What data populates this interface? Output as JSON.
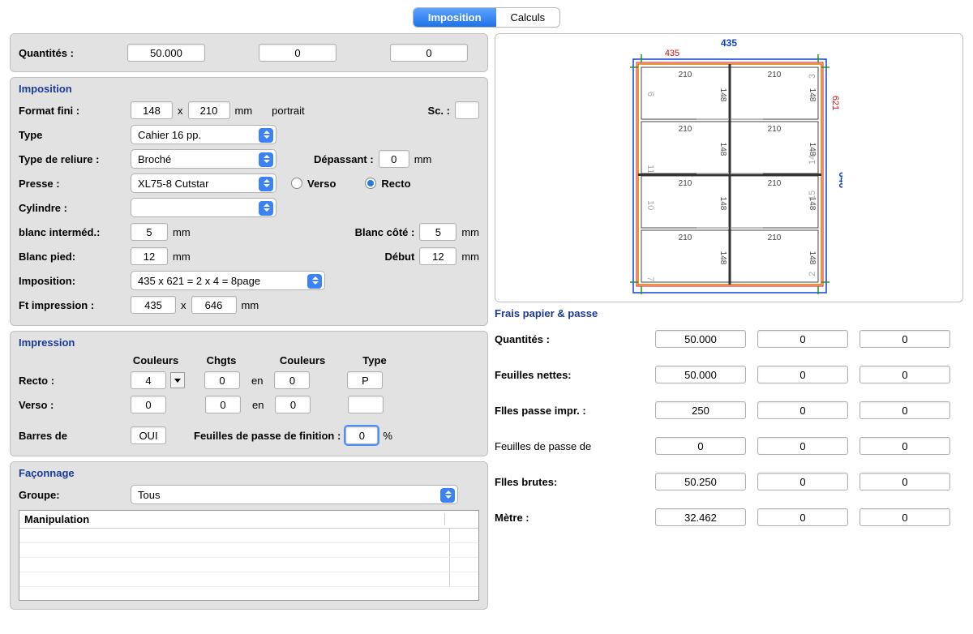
{
  "tabs": {
    "imposition": "Imposition",
    "calculs": "Calculs"
  },
  "quantites": {
    "label": "Quantités :",
    "v1": "50.000",
    "v2": "0",
    "v3": "0"
  },
  "imposition": {
    "title": "Imposition",
    "format_fini_label": "Format fini :",
    "format_w": "148",
    "format_x": "x",
    "format_h": "210",
    "mm": "mm",
    "orientation": "portrait",
    "sc_label": "Sc. :",
    "sc_value": "",
    "type_label": "Type",
    "type_value": "Cahier 16 pp.",
    "reliure_label": "Type de reliure :",
    "reliure_value": "Broché",
    "depassant_label": "Dépassant :",
    "depassant_value": "0",
    "depassant_unit": "mm",
    "presse_label": "Presse :",
    "presse_value": "XL75-8 Cutstar",
    "verso_label": "Verso",
    "recto_label": "Recto",
    "cylindre_label": "Cylindre :",
    "cylindre_value": "",
    "blanc_intermed_label": "blanc interméd.:",
    "blanc_intermed_value": "5",
    "blanc_cote_label": "Blanc côté :",
    "blanc_cote_value": "5",
    "blanc_pied_label": "Blanc pied:",
    "blanc_pied_value": "12",
    "debut_label": "Début",
    "debut_value": "12",
    "imposition_label": "Imposition:",
    "imposition_value": "435 x 621 = 2 x 4 = 8page",
    "ft_label": "Ft impression :",
    "ft_w": "435",
    "ft_h": "646"
  },
  "impression": {
    "title": "Impression",
    "col_couleurs": "Couleurs",
    "col_chgts": "Chgts",
    "col_couleurs2": "Couleurs",
    "col_type": "Type",
    "en": "en",
    "recto_label": "Recto :",
    "recto_couleurs": "4",
    "recto_chgts": "0",
    "recto_couleurs2": "0",
    "recto_type": "P",
    "verso_label": "Verso :",
    "verso_couleurs": "0",
    "verso_chgts": "0",
    "verso_couleurs2": "0",
    "verso_type": "",
    "barres_label": "Barres de",
    "barres_value": "OUI",
    "feuilles_finition_label": "Feuilles de passe de finition :",
    "feuilles_finition_value": "0",
    "percent": "%"
  },
  "faconnage": {
    "title": "Façonnage",
    "groupe_label": "Groupe:",
    "groupe_value": "Tous",
    "manipulation_header": "Manipulation"
  },
  "diagram": {
    "outer_w": "435",
    "outer_inner_w": "435",
    "side_h": "621",
    "side_h2": "646",
    "cell_w": "210",
    "cell_h": "148",
    "page_nums": [
      "6",
      "3",
      "11",
      "14",
      "10",
      "15",
      "7",
      "2"
    ]
  },
  "frais": {
    "title": "Frais papier & passe",
    "quantites_label": "Quantités :",
    "q1": "50.000",
    "q2": "0",
    "q3": "0",
    "nettes_label": "Feuilles nettes:",
    "n1": "50.000",
    "n2": "0",
    "n3": "0",
    "passe_impr_label": "Flles passe impr. :",
    "pi1": "250",
    "pi2": "0",
    "pi3": "0",
    "passe_de_label": "Feuilles de passe de",
    "pd1": "0",
    "pd2": "0",
    "pd3": "0",
    "brutes_label": "Flles brutes:",
    "b1": "50.250",
    "b2": "0",
    "b3": "0",
    "metre_label": "Mètre :",
    "m1": "32.462",
    "m2": "0",
    "m3": "0"
  }
}
